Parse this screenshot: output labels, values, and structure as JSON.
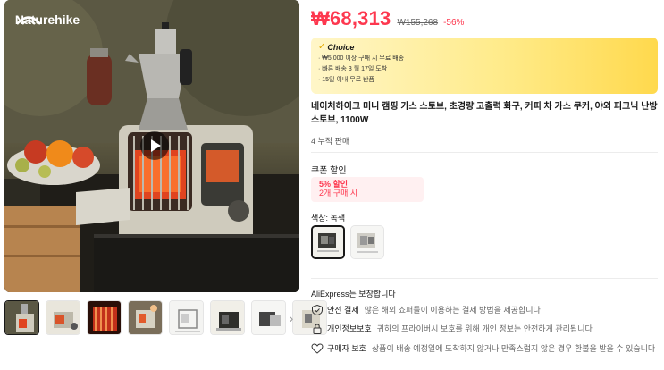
{
  "gallery": {
    "brand": "Naturehike",
    "thumbnail_count": 9
  },
  "price": {
    "current": "₩68,313",
    "original": "₩155,268",
    "discount": "-56%"
  },
  "choice": {
    "badge": "Choice",
    "lines": [
      "· ₩5,000 이상 구매 시 무료 배송",
      "· 빠른 배송 3 월 17일 도착",
      "· 15일 이내 무료 반품"
    ]
  },
  "product": {
    "title": "네이처하이크 미니 캠핑 가스 스토브, 초경량 고출력 화구, 커피 차 가스 쿠커, 야외 피크닉 난방 스토브, 1100W",
    "sold": "4 누적 판매"
  },
  "coupon": {
    "label": "쿠폰 할인",
    "main": "5% 할인",
    "sub": "2개 구매 시"
  },
  "color": {
    "label": "색상: 녹색"
  },
  "assurance": {
    "title": "AliExpress는 보장합니다",
    "items": [
      {
        "icon": "shield-check-icon",
        "heading": "안전 결제",
        "text": "많은 해외 쇼퍼들이 이용하는 결제 방법을 제공합니다"
      },
      {
        "icon": "lock-icon",
        "heading": "개인정보보호",
        "text": "귀하의 프라이버시 보호를 위해 개인 정보는 안전하게 관리됩니다"
      },
      {
        "icon": "heart-shield-icon",
        "heading": "구매자 보호",
        "text": "상품이 배송 예정일에 도착하지 않거나 만족스럽지 않은 경우 환불을 받을 수 있습니다"
      }
    ]
  },
  "colors": {
    "price": "#fd384f",
    "choice_gradient_end": "#ffd94d"
  }
}
